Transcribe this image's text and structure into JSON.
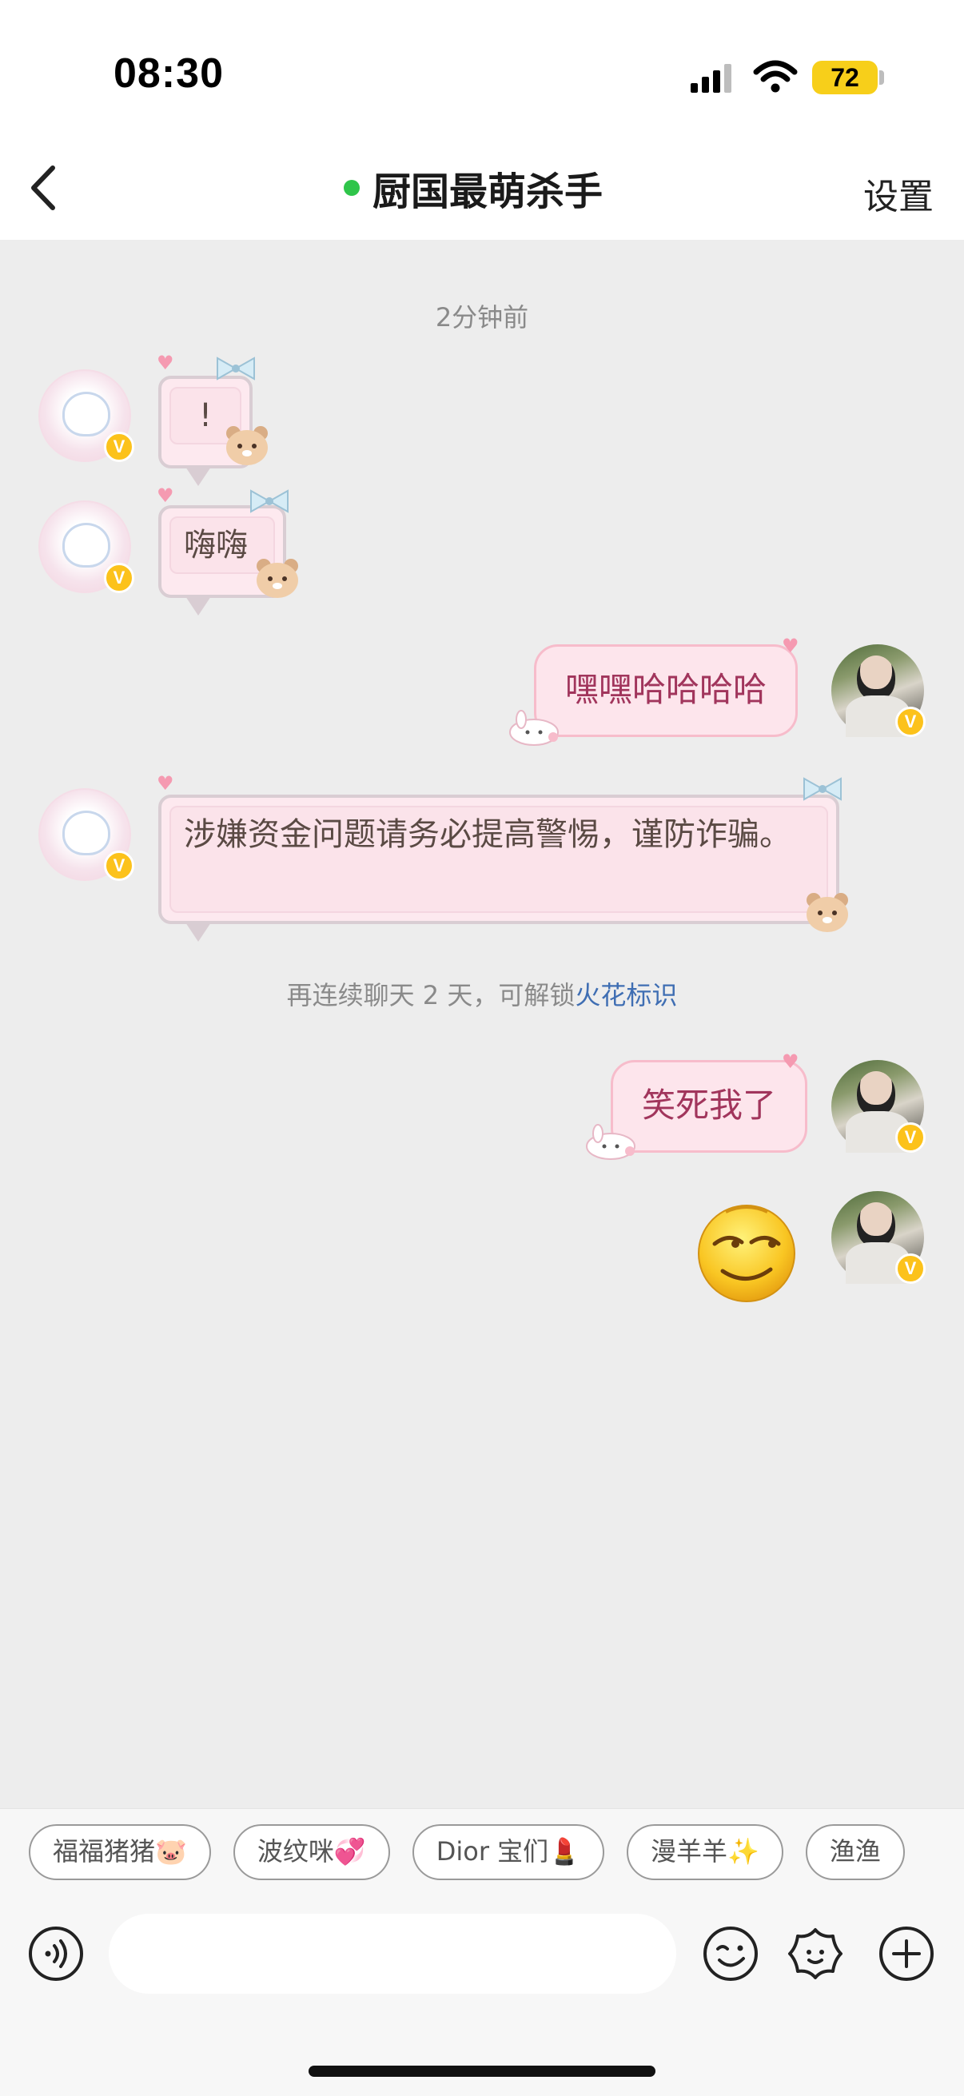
{
  "status_bar": {
    "time": "08:30",
    "battery": "72"
  },
  "header": {
    "title": "厨国最萌杀手",
    "online": true,
    "settings_label": "设置"
  },
  "conversation": {
    "timestamp": "2分钟前",
    "messages": [
      {
        "from": "friend",
        "text": "!"
      },
      {
        "from": "friend",
        "text": "嗨嗨"
      },
      {
        "from": "self",
        "text": "嘿嘿哈哈哈哈"
      },
      {
        "from": "friend",
        "text": "涉嫌资金问题请务必提高警惕，谨防诈骗。"
      },
      {
        "from": "self",
        "text": "笑死我了"
      },
      {
        "from": "self",
        "type": "emoji",
        "emoji": "smirk-face-icon"
      }
    ],
    "system_note": {
      "prefix": "再连续聊天 2 天，可解锁",
      "link": "火花标识"
    },
    "badge_label": "V"
  },
  "quick_replies": [
    "福福猪猪🐷",
    "波纹咪💞",
    "Dior 宝们💄",
    "漫羊羊✨",
    "渔渔"
  ],
  "composer": {
    "placeholder": ""
  },
  "colors": {
    "online_dot": "#2fc54a",
    "badge": "#fcc21b",
    "outgoing_text": "#a1355c",
    "link": "#3f6eb3"
  }
}
